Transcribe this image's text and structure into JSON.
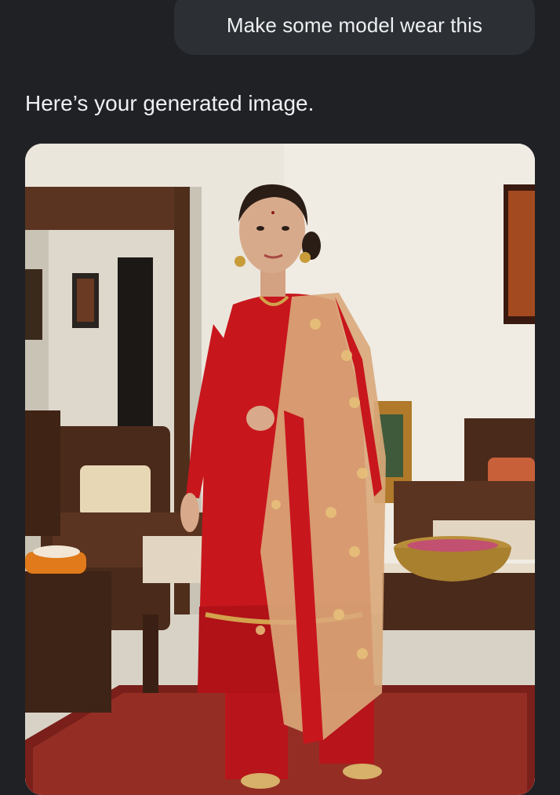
{
  "conversation": {
    "user_message": "Make some model wear this",
    "assistant_reply": "Here’s your generated image."
  },
  "image": {
    "alt": "Generated image of a model wearing a red embroidered kurta with a net dupatta"
  },
  "colors": {
    "background": "#1f2124",
    "bubble": "#2c2f33",
    "text": "#eef0f2",
    "kurta": "#c8161d",
    "dupatta": "#d9a97a",
    "wood": "#4a2a1a"
  }
}
